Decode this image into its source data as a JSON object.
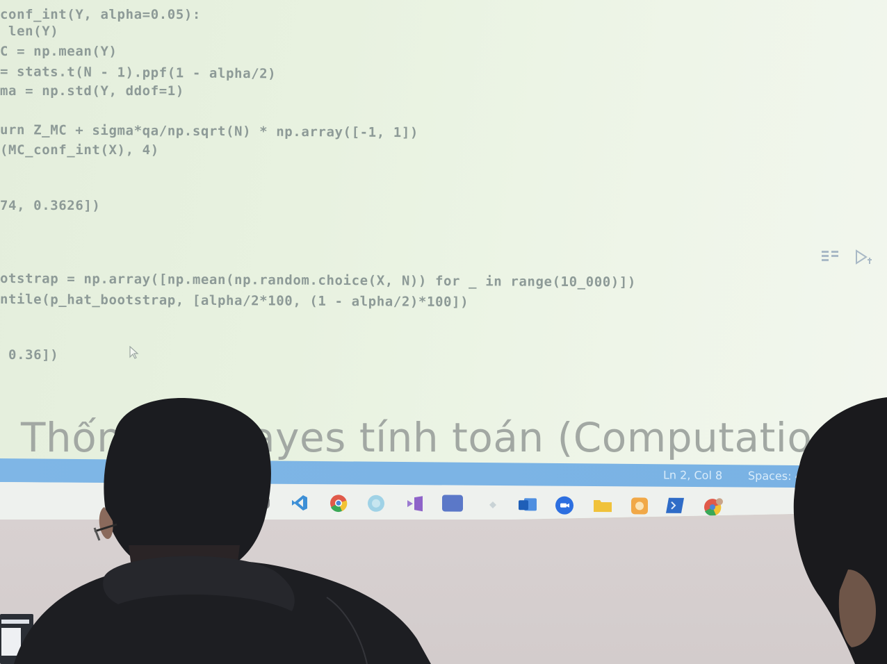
{
  "code_lines": [
    "conf_int(Y, alpha=0.05):",
    " len(Y)",
    "C = np.mean(Y)",
    "= stats.t(N - 1).ppf(1 - alpha/2)",
    "ma = np.std(Y, ddof=1)",
    "",
    "urn Z_MC + sigma*qa/np.sqrt(N) * np.array([-1, 1])",
    "(MC_conf_int(X), 4)",
    "",
    "74, 0.3626])",
    "",
    "",
    "otstrap = np.array([np.mean(np.random.choice(X, N)) for _ in range(10_000)])",
    "ntile(p_hat_bootstrap, [alpha/2*100, (1 - alpha/2)*100])",
    "",
    " 0.36])"
  ],
  "heading_text": "Thống kê Bayes tính toán (Computatio",
  "status_bar": {
    "position": "Ln 2, Col 8",
    "spaces": "Spaces: 4"
  },
  "colors": {
    "statusbar": "#79b2e4",
    "code_text": "#8d9a97",
    "heading": "#a2a8a3"
  },
  "taskbar_icons": [
    "windows-stop-icon",
    "vscode-icon",
    "chrome-icon",
    "copilot-icon",
    "visual-studio-icon",
    "monitor-app-icon",
    "onedrive-icon",
    "outlook-icon",
    "zoom-icon",
    "file-explorer-icon",
    "paint-icon",
    "terminal-icon",
    "chrome-profile-icon"
  ]
}
